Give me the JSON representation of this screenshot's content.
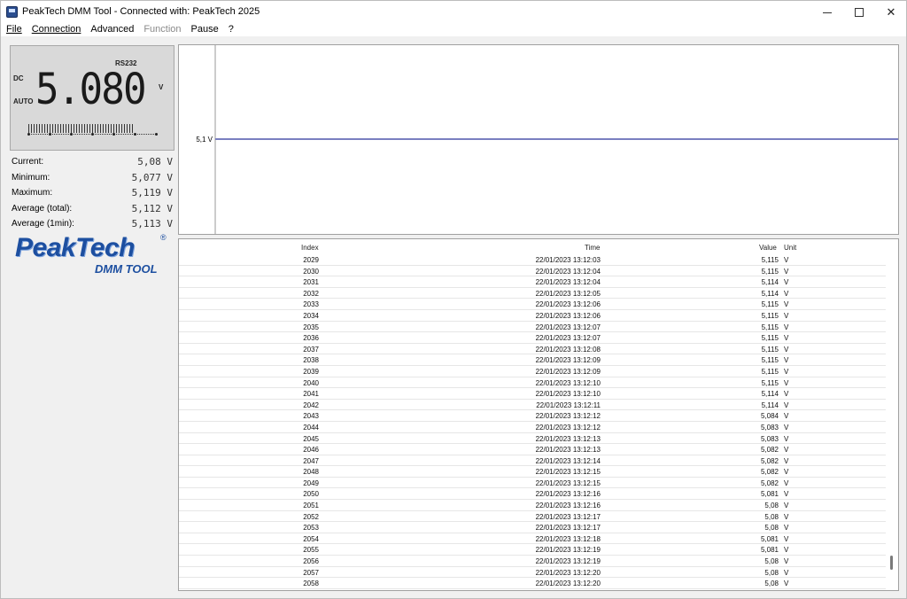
{
  "window": {
    "title": "PeakTech DMM Tool - Connected with: PeakTech 2025",
    "minimize": "",
    "maximize": "",
    "close": "✕"
  },
  "menu": [
    {
      "label": "File",
      "underline": true
    },
    {
      "label": "Connection",
      "underline": true
    },
    {
      "label": "Advanced",
      "underline": false
    },
    {
      "label": "Function",
      "underline": false,
      "disabled": true
    },
    {
      "label": "Pause",
      "underline": false
    },
    {
      "label": "?",
      "underline": false
    }
  ],
  "lcd": {
    "interface": "RS232",
    "mode": "DC",
    "range": "AUTO",
    "reading": "5.080",
    "unit": "V",
    "bargraph_fraction": 0.82
  },
  "stats": [
    {
      "label": "Current:",
      "value": "5,08  V"
    },
    {
      "label": "Minimum:",
      "value": "5,077 V"
    },
    {
      "label": "Maximum:",
      "value": "5,119 V"
    },
    {
      "label": "Average (total):",
      "value": "5,112 V"
    },
    {
      "label": "Average (1min):",
      "value": "5,113 V"
    }
  ],
  "logo": {
    "main": "PeakTech",
    "registered": "®",
    "sub": "DMM TOOL"
  },
  "chart_data": {
    "type": "line",
    "ytick_labels": [
      "5,1 V"
    ],
    "series_value": 5.1,
    "line_color": "#7a7fc0"
  },
  "table": {
    "headers": {
      "index": "Index",
      "time": "Time",
      "value": "Value",
      "unit": "Unit"
    },
    "rows": [
      [
        "2029",
        "22/01/2023 13:12:03",
        "5,115",
        "V"
      ],
      [
        "2030",
        "22/01/2023 13:12:04",
        "5,115",
        "V"
      ],
      [
        "2031",
        "22/01/2023 13:12:04",
        "5,114",
        "V"
      ],
      [
        "2032",
        "22/01/2023 13:12:05",
        "5,114",
        "V"
      ],
      [
        "2033",
        "22/01/2023 13:12:06",
        "5,115",
        "V"
      ],
      [
        "2034",
        "22/01/2023 13:12:06",
        "5,115",
        "V"
      ],
      [
        "2035",
        "22/01/2023 13:12:07",
        "5,115",
        "V"
      ],
      [
        "2036",
        "22/01/2023 13:12:07",
        "5,115",
        "V"
      ],
      [
        "2037",
        "22/01/2023 13:12:08",
        "5,115",
        "V"
      ],
      [
        "2038",
        "22/01/2023 13:12:09",
        "5,115",
        "V"
      ],
      [
        "2039",
        "22/01/2023 13:12:09",
        "5,115",
        "V"
      ],
      [
        "2040",
        "22/01/2023 13:12:10",
        "5,115",
        "V"
      ],
      [
        "2041",
        "22/01/2023 13:12:10",
        "5,114",
        "V"
      ],
      [
        "2042",
        "22/01/2023 13:12:11",
        "5,114",
        "V"
      ],
      [
        "2043",
        "22/01/2023 13:12:12",
        "5,084",
        "V"
      ],
      [
        "2044",
        "22/01/2023 13:12:12",
        "5,083",
        "V"
      ],
      [
        "2045",
        "22/01/2023 13:12:13",
        "5,083",
        "V"
      ],
      [
        "2046",
        "22/01/2023 13:12:13",
        "5,082",
        "V"
      ],
      [
        "2047",
        "22/01/2023 13:12:14",
        "5,082",
        "V"
      ],
      [
        "2048",
        "22/01/2023 13:12:15",
        "5,082",
        "V"
      ],
      [
        "2049",
        "22/01/2023 13:12:15",
        "5,082",
        "V"
      ],
      [
        "2050",
        "22/01/2023 13:12:16",
        "5,081",
        "V"
      ],
      [
        "2051",
        "22/01/2023 13:12:16",
        "5,08",
        "V"
      ],
      [
        "2052",
        "22/01/2023 13:12:17",
        "5,08",
        "V"
      ],
      [
        "2053",
        "22/01/2023 13:12:17",
        "5,08",
        "V"
      ],
      [
        "2054",
        "22/01/2023 13:12:18",
        "5,081",
        "V"
      ],
      [
        "2055",
        "22/01/2023 13:12:19",
        "5,081",
        "V"
      ],
      [
        "2056",
        "22/01/2023 13:12:19",
        "5,08",
        "V"
      ],
      [
        "2057",
        "22/01/2023 13:12:20",
        "5,08",
        "V"
      ],
      [
        "2058",
        "22/01/2023 13:12:20",
        "5,08",
        "V"
      ]
    ],
    "scroll_position": 0.97
  }
}
